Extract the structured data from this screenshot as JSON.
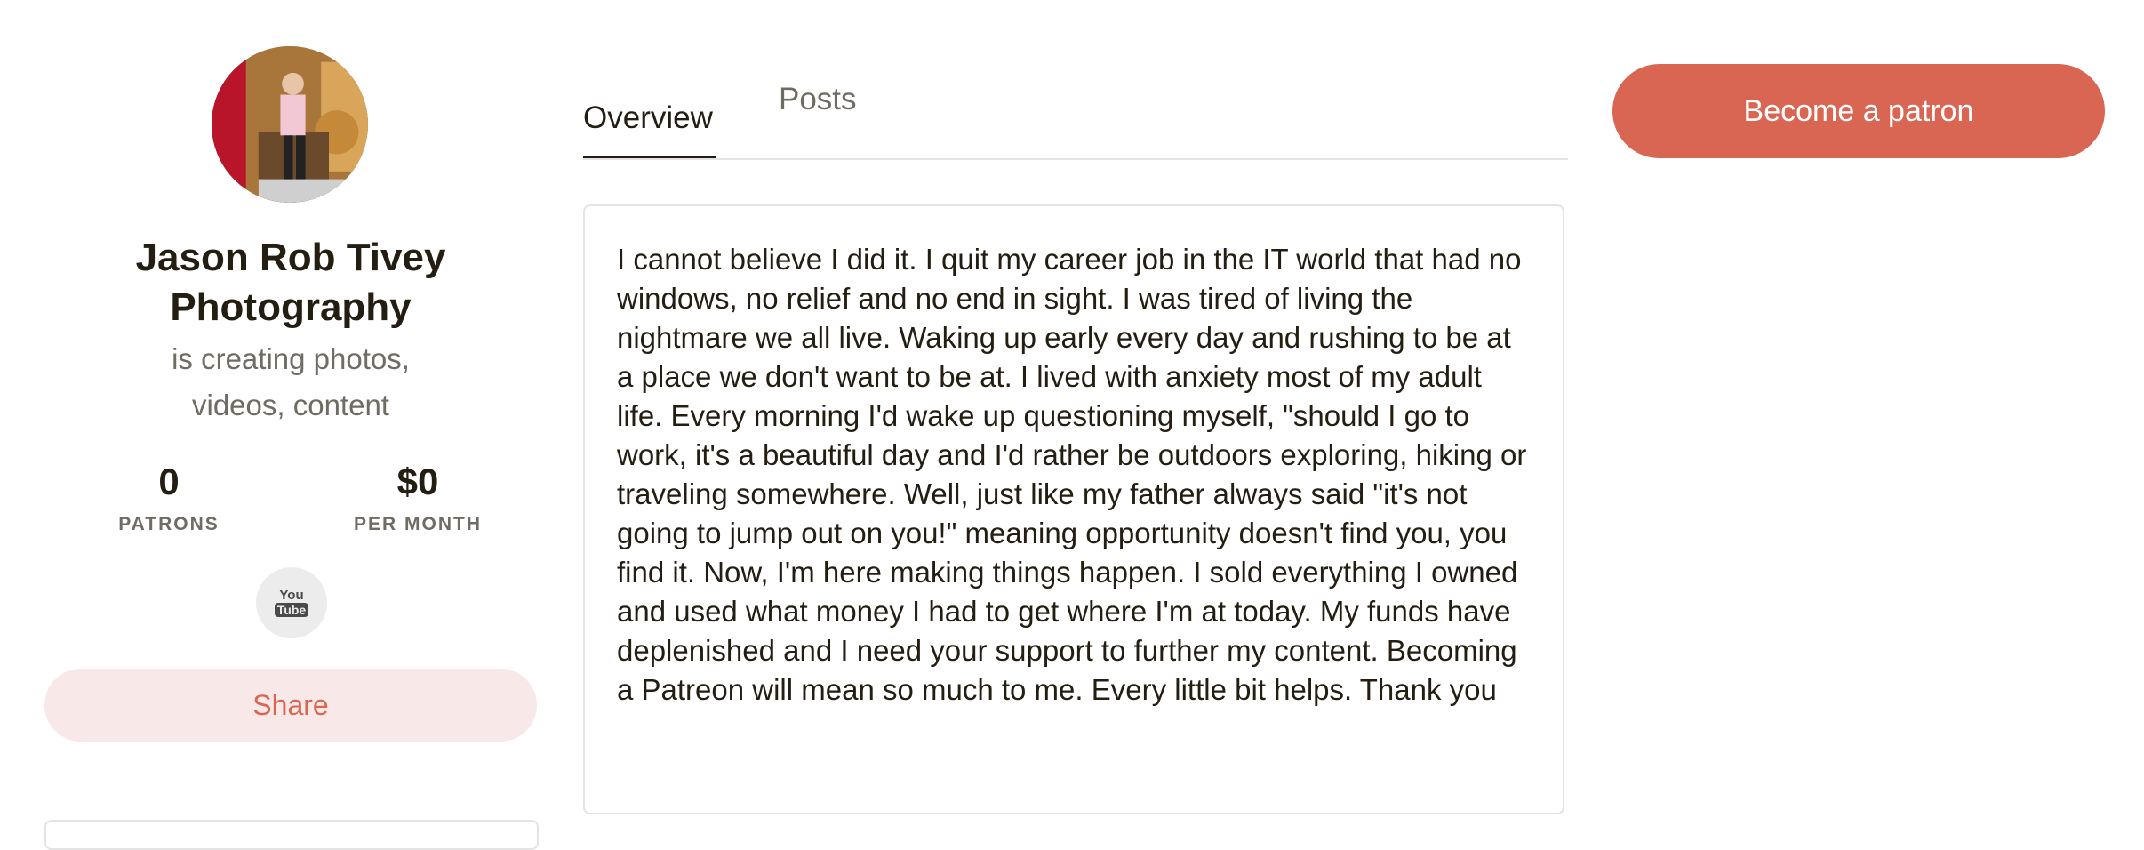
{
  "creator": {
    "name": "Jason Rob Tivey Photography",
    "tagline": "is creating photos, videos, content"
  },
  "stats": {
    "patrons_value": "0",
    "patrons_label": "PATRONS",
    "earnings_value": "$0",
    "earnings_label": "PER MONTH"
  },
  "social": {
    "youtube_top": "You",
    "youtube_bottom": "Tube",
    "icon": "youtube-icon"
  },
  "actions": {
    "share_label": "Share",
    "become_patron_label": "Become a patron"
  },
  "tabs": [
    {
      "label": "Overview",
      "active": true
    },
    {
      "label": "Posts",
      "active": false
    }
  ],
  "about": {
    "text": "I cannot believe I did it. I quit my career job in the IT world that had no windows, no relief and no end in sight. I was tired of living the nightmare we all live. Waking up early every day and rushing to be at a place we don't want to be at. I lived with anxiety most of my adult life. Every morning I'd wake up questioning myself, \"should I go to work, it's a beautiful day and I'd rather be outdoors exploring, hiking or traveling somewhere. Well, just like my father always said \"it's not going to jump out on you!\" meaning opportunity doesn't find you, you find it. Now, I'm here making things happen. I sold everything I owned and used what money I had to get where I'm at today. My funds have deplenished and I need your support to further my content. Becoming a Patreon will mean so much to me. Every little bit helps. Thank you"
  },
  "colors": {
    "accent": "#d96652",
    "accent_light": "#f8e9e8",
    "text_primary": "#241e12",
    "text_muted": "#706c64",
    "border": "#e4e4e4"
  }
}
